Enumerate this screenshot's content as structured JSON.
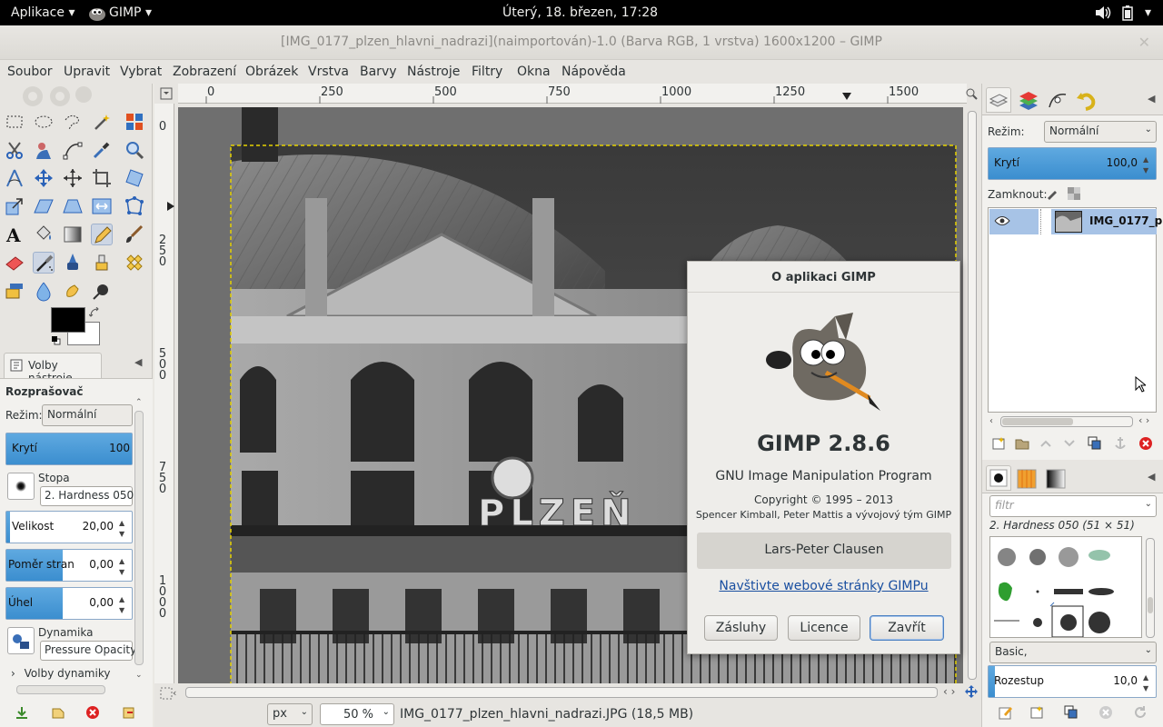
{
  "topbar": {
    "applications": "Aplikace ▾",
    "app_name": "GIMP ▾",
    "clock": "Úterý, 18. březen, 17:28"
  },
  "window": {
    "title": "[IMG_0177_plzen_hlavni_nadrazi](naimportován)-1.0 (Barva RGB, 1 vrstva) 1600x1200 – GIMP"
  },
  "menu": [
    "Soubor",
    "Upravit",
    "Vybrat",
    "Zobrazení",
    "Obrázek",
    "Vrstva",
    "Barvy",
    "Nástroje",
    "Filtry",
    "Okna",
    "Nápověda"
  ],
  "tool_options": {
    "tab_label": "Volby nástroje",
    "tool_name": "Rozprašovač",
    "mode_label": "Režim:",
    "mode_value": "Normální",
    "opacity_label": "Krytí",
    "opacity_value": "100",
    "brush_label": "Stopa",
    "brush_value": "2. Hardness 050",
    "size_label": "Velikost",
    "size_value": "20,00",
    "ratio_label": "Poměr stran",
    "ratio_value": "0,00",
    "angle_label": "Úhel",
    "angle_value": "0,00",
    "dynamics_label": "Dynamika",
    "dynamics_value": "Pressure Opacity",
    "dynamics_options": "Volby dynamiky"
  },
  "ruler": {
    "h_ticks": [
      "0",
      "250",
      "500",
      "750",
      "1000",
      "1250",
      "1500"
    ],
    "v_ticks": [
      "0",
      "250",
      "500",
      "750",
      "1000"
    ]
  },
  "statusbar": {
    "unit": "px",
    "zoom": "50 %",
    "file_info": "IMG_0177_plzen_hlavni_nadrazi.JPG (18,5 MB)"
  },
  "layers": {
    "mode_label": "Režim:",
    "mode_value": "Normální",
    "opacity_label": "Krytí",
    "opacity_value": "100,0",
    "lock_label": "Zamknout:",
    "layer_name": "IMG_0177_p"
  },
  "brushes": {
    "filter_placeholder": "filtr",
    "brush_title": "2. Hardness 050 (51 × 51)",
    "set_value": "Basic,",
    "spacing_label": "Rozestup",
    "spacing_value": "10,0"
  },
  "about_dialog": {
    "title": "O aplikaci GIMP",
    "version": "GIMP 2.8.6",
    "program_name": "GNU Image Manipulation Program",
    "copyright": "Copyright © 1995 – 2013",
    "authors": "Spencer Kimball, Peter Mattis a vývojový tým GIMP",
    "credit_name": "Lars-Peter Clausen",
    "website_link": "Navštivte webové stránky GIMPu",
    "btn_credits": "Zásluhy",
    "btn_license": "Licence",
    "btn_close": "Zavřít"
  },
  "colors": {
    "accent_blue": "#3b8ecf",
    "fg_color": "#000000",
    "bg_color": "#ffffff",
    "topbar_bg": "#000000"
  },
  "image_sign": "PLZEŇ"
}
